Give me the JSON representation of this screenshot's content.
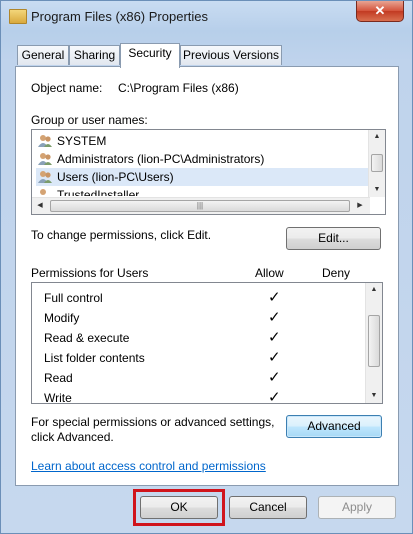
{
  "window": {
    "title": "Program Files (x86) Properties",
    "close_glyph": "✕"
  },
  "tabs": [
    {
      "label": "General"
    },
    {
      "label": "Sharing"
    },
    {
      "label": "Security"
    },
    {
      "label": "Previous Versions"
    }
  ],
  "security": {
    "object_name_label": "Object name:",
    "object_name_value": "C:\\Program Files (x86)",
    "group_label": "Group or user names:",
    "groups": [
      {
        "name": "SYSTEM"
      },
      {
        "name": "Administrators (lion-PC\\Administrators)"
      },
      {
        "name": "Users (lion-PC\\Users)"
      },
      {
        "name": "TrustedInstaller"
      }
    ],
    "change_text": "To change permissions, click Edit.",
    "edit_label": "Edit...",
    "permissions_for": "Permissions for Users",
    "allow_label": "Allow",
    "deny_label": "Deny",
    "permissions": [
      {
        "name": "Full control",
        "allow": "✓"
      },
      {
        "name": "Modify",
        "allow": "✓"
      },
      {
        "name": "Read & execute",
        "allow": "✓"
      },
      {
        "name": "List folder contents",
        "allow": "✓"
      },
      {
        "name": "Read",
        "allow": "✓"
      },
      {
        "name": "Write",
        "allow": "✓"
      }
    ],
    "special_text_1": "For special permissions or advanced settings,",
    "special_text_2": "click Advanced.",
    "advanced_label": "Advanced",
    "learn_link": "Learn about access control and permissions"
  },
  "footer": {
    "ok_label": "OK",
    "cancel_label": "Cancel",
    "apply_label": "Apply"
  },
  "colors": {
    "highlight": "#d0141c",
    "link": "#0066cc"
  }
}
